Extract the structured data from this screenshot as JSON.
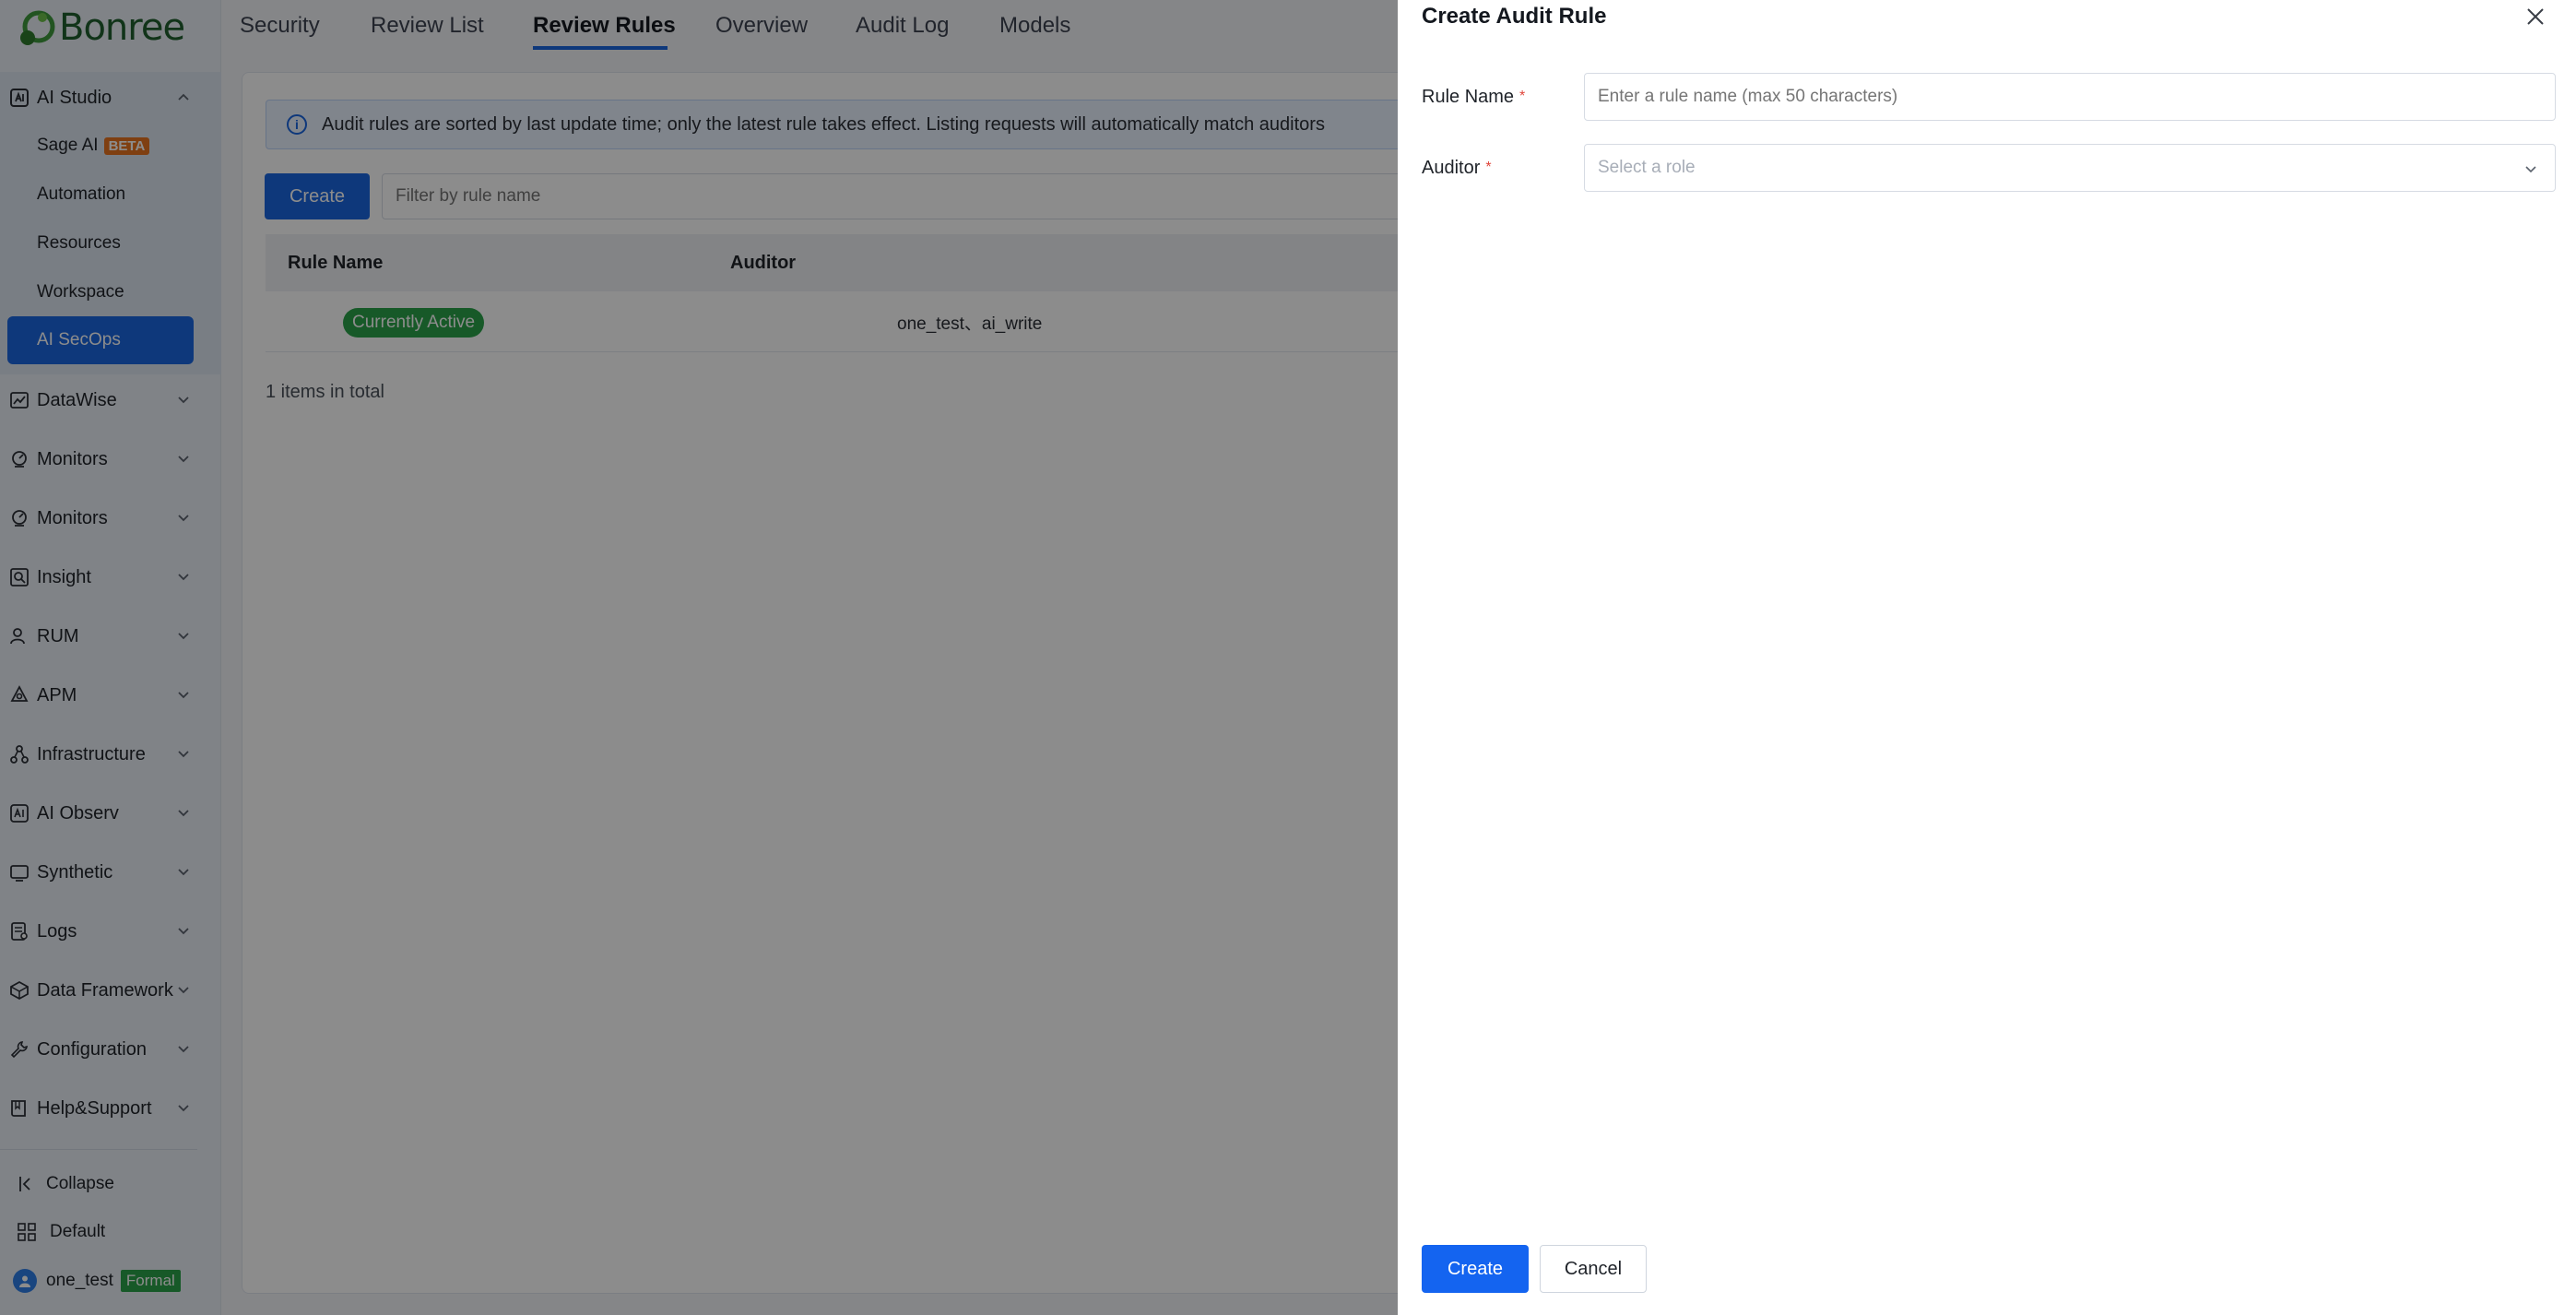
{
  "brand": {
    "name": "Bonree",
    "logo_color": "#1f5f2e",
    "accent": "#1a66e0"
  },
  "sidebar": {
    "studio": {
      "label": "AI Studio",
      "items": [
        {
          "label": "Sage AI",
          "badge": "BETA"
        },
        {
          "label": "Automation"
        },
        {
          "label": "Resources"
        },
        {
          "label": "Workspace"
        },
        {
          "label": "AI SecOps",
          "active": true
        }
      ]
    },
    "groups": [
      {
        "label": "DataWise",
        "icon": "chart-icon"
      },
      {
        "label": "Monitors",
        "icon": "monitor-icon"
      },
      {
        "label": "Monitors",
        "icon": "monitor-icon"
      },
      {
        "label": "Insight",
        "icon": "insight-icon"
      },
      {
        "label": "RUM",
        "icon": "user-icon"
      },
      {
        "label": "APM",
        "icon": "apm-icon"
      },
      {
        "label": "Infrastructure",
        "icon": "infrastructure-icon"
      },
      {
        "label": "AI Observ",
        "icon": "ai-icon"
      },
      {
        "label": "Synthetic",
        "icon": "synthetic-icon"
      },
      {
        "label": "Logs",
        "icon": "logs-icon"
      },
      {
        "label": "Data Framework",
        "icon": "framework-icon"
      },
      {
        "label": "Configuration",
        "icon": "wrench-icon"
      },
      {
        "label": "Help&Support",
        "icon": "book-icon"
      }
    ],
    "footer": {
      "collapse": "Collapse",
      "default": "Default",
      "user": "one_test",
      "user_badge": "Formal"
    }
  },
  "tabs": [
    {
      "label": "Security"
    },
    {
      "label": "Review List"
    },
    {
      "label": "Review Rules",
      "active": true
    },
    {
      "label": "Overview"
    },
    {
      "label": "Audit Log"
    },
    {
      "label": "Models"
    }
  ],
  "main": {
    "notice": "Audit rules are sorted by last update time; only the latest rule takes effect. Listing requests will automatically match auditors",
    "create_label": "Create",
    "filter_placeholder": "Filter by rule name",
    "columns": [
      "Rule Name",
      "Auditor"
    ],
    "rows": [
      {
        "status_tag": "Currently Active",
        "auditors": "one_test、ai_write"
      }
    ],
    "total": "1 items in total"
  },
  "drawer": {
    "title": "Create Audit Rule",
    "fields": {
      "rule_name": {
        "label": "Rule Name",
        "required": "*",
        "placeholder": "Enter a rule name (max 50 characters)"
      },
      "auditor": {
        "label": "Auditor",
        "required": "*",
        "placeholder": "Select a role"
      }
    },
    "create_label": "Create",
    "cancel_label": "Cancel"
  }
}
